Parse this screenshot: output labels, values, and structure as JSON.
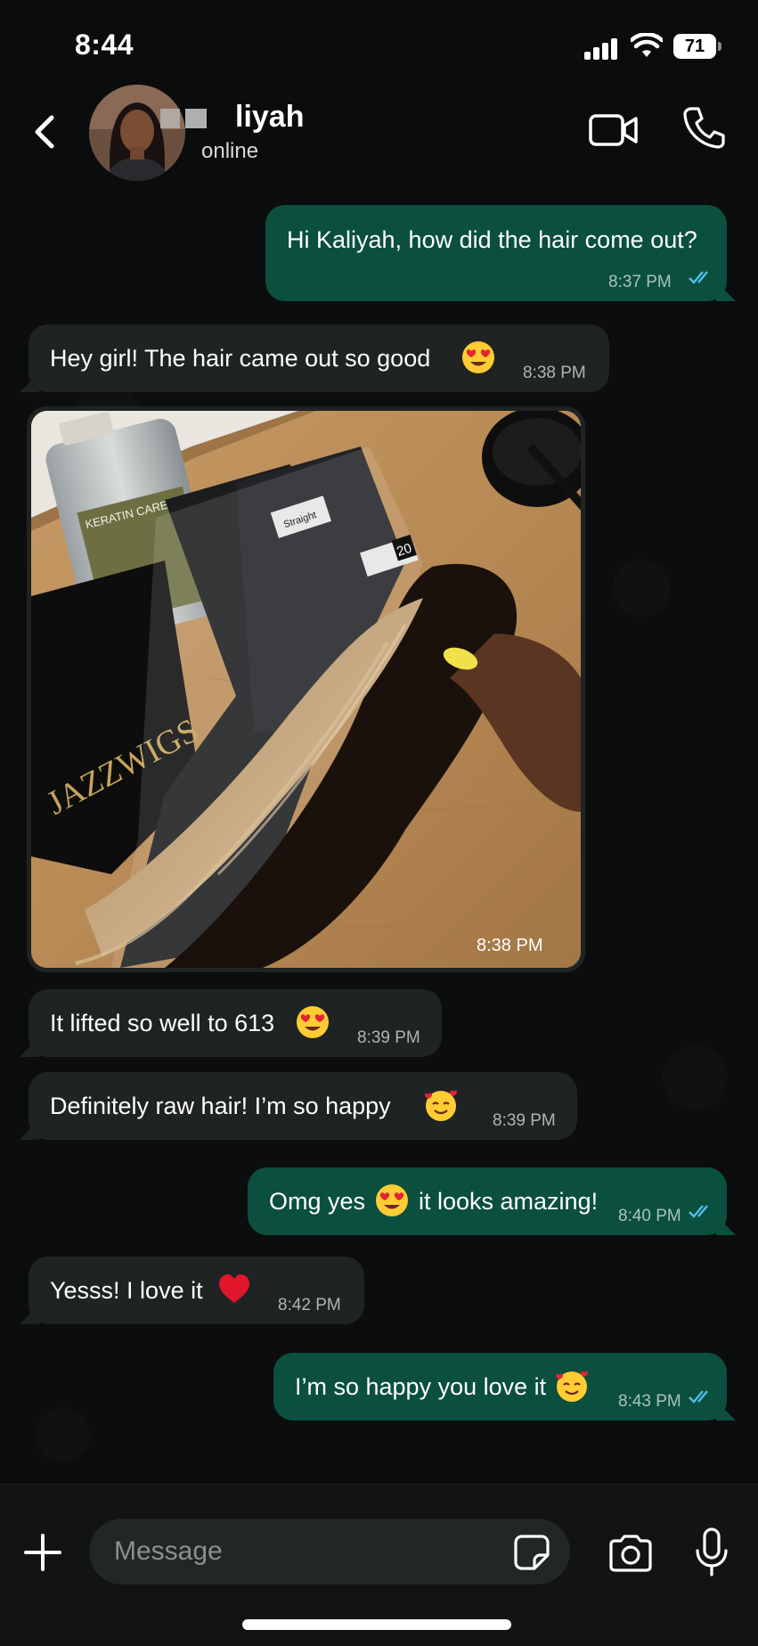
{
  "status_bar": {
    "time": "8:44",
    "battery": "71"
  },
  "header": {
    "name": "liyah",
    "status": "online"
  },
  "messages": [
    {
      "dir": "out",
      "text": "Hi Kaliyah, how did the hair come out?",
      "time": "8:37 PM"
    },
    {
      "dir": "in",
      "text": "Hey girl! The hair came out so good",
      "time": "8:38 PM",
      "emoji": "heart-eyes"
    },
    {
      "dir": "in",
      "type": "photo",
      "time": "8:38 PM",
      "photo_text": {
        "bottle": "KERATIN CARE02",
        "box": "JAZZWIGS",
        "tag": "20",
        "label": "Straight"
      }
    },
    {
      "dir": "in",
      "text": "It lifted so well to 613",
      "time": "8:39 PM",
      "emoji": "heart-eyes"
    },
    {
      "dir": "in",
      "text": "Definitely raw hair! I’m so happy",
      "time": "8:39 PM",
      "emoji": "smiling-hearts"
    },
    {
      "dir": "out",
      "text_before": "Omg yes",
      "text_after": "it looks amazing!",
      "time": "8:40 PM",
      "emoji": "heart-eyes"
    },
    {
      "dir": "in",
      "text": "Yesss! I love it",
      "time": "8:42 PM",
      "emoji": "red-heart"
    },
    {
      "dir": "out",
      "text": "I’m so happy you love it",
      "time": "8:43 PM",
      "emoji": "smiling-hearts"
    }
  ],
  "composer": {
    "placeholder": "Message"
  },
  "colors": {
    "outgoing_bubble": "#0b4f3e",
    "incoming_bubble": "#1f2323",
    "read_ticks": "#53bdeb",
    "background": "#0b0c0c"
  }
}
